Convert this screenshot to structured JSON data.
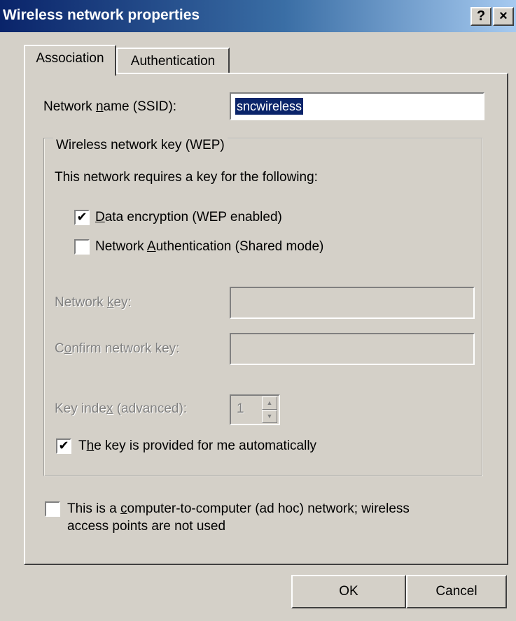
{
  "window": {
    "title": "Wireless network properties",
    "help_glyph": "?",
    "close_glyph": "×"
  },
  "tabs": [
    {
      "label": "Association",
      "selected": true
    },
    {
      "label": "Authentication",
      "selected": false
    }
  ],
  "ssid": {
    "label_pre": "Network ",
    "label_mnemonic": "n",
    "label_post": "ame (SSID):",
    "value": "sncwireless"
  },
  "wep_group": {
    "legend": "Wireless network key (WEP)",
    "requires_text": "This network requires a key for the following:",
    "data_encryption": {
      "checked": true,
      "label_mnemonic": "D",
      "label_post": "ata encryption (WEP enabled)"
    },
    "network_auth": {
      "checked": false,
      "label_pre": "Network ",
      "label_mnemonic": "A",
      "label_post": "uthentication (Shared mode)"
    },
    "network_key": {
      "label_pre": "Network ",
      "label_mnemonic": "k",
      "label_post": "ey:",
      "value": ""
    },
    "confirm_key": {
      "label_pre": "C",
      "label_mnemonic": "o",
      "label_post": "nfirm network key:",
      "value": ""
    },
    "key_index": {
      "label_pre": "Key inde",
      "label_mnemonic": "x",
      "label_post": " (advanced):",
      "value": "1"
    },
    "auto_key": {
      "checked": true,
      "label_pre": "T",
      "label_mnemonic": "h",
      "label_post": "e key is provided for me automatically"
    }
  },
  "adhoc": {
    "checked": false,
    "line1_pre": "This is a ",
    "line1_mnemonic": "c",
    "line1_post": "omputer-to-computer (ad hoc) network; wireless",
    "line2": "access points are not used"
  },
  "buttons": {
    "ok": "OK",
    "cancel": "Cancel"
  },
  "glyphs": {
    "check": "✔",
    "spin_up": "▲",
    "spin_down": "▼"
  }
}
